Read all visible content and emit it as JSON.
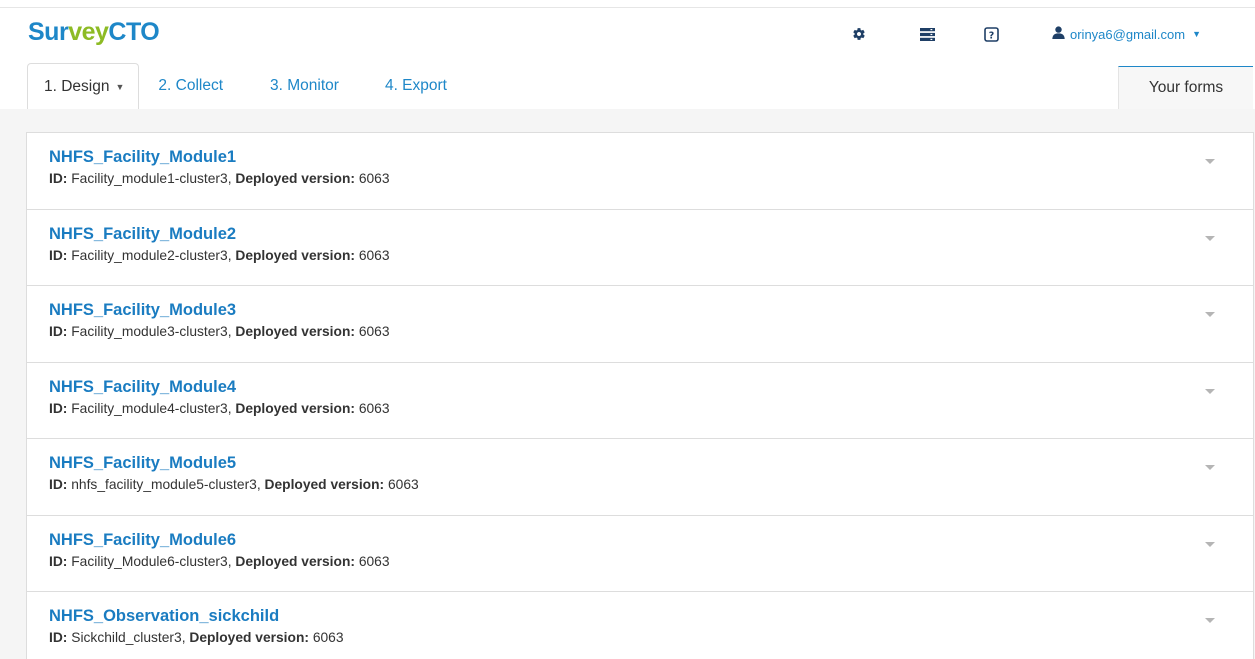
{
  "brand": {
    "part1": "Sur",
    "part2": "vey",
    "part3": "CTO",
    "colors": {
      "blue": "#1e87c8",
      "green": "#8dbb24"
    }
  },
  "header_icons": {
    "settings": "gear-icon",
    "servers": "server-stack-icon",
    "help": "help-icon"
  },
  "account": {
    "icon": "user-icon",
    "email": "orinya6@gmail.com"
  },
  "tabs": [
    {
      "label": "1. Design"
    },
    {
      "label": "2. Collect"
    },
    {
      "label": "3. Monitor"
    },
    {
      "label": "4. Export"
    }
  ],
  "your_forms": "Your forms",
  "labels": {
    "id": "ID:",
    "deployed": "Deployed version:"
  },
  "forms": [
    {
      "title": "NHFS_Facility_Module1",
      "id": "Facility_module1-cluster3",
      "version": "6063"
    },
    {
      "title": "NHFS_Facility_Module2",
      "id": "Facility_module2-cluster3",
      "version": "6063"
    },
    {
      "title": "NHFS_Facility_Module3",
      "id": "Facility_module3-cluster3",
      "version": "6063"
    },
    {
      "title": "NHFS_Facility_Module4",
      "id": "Facility_module4-cluster3",
      "version": "6063"
    },
    {
      "title": "NHFS_Facility_Module5",
      "id": "nhfs_facility_module5-cluster3",
      "version": "6063"
    },
    {
      "title": "NHFS_Facility_Module6",
      "id": "Facility_Module6-cluster3",
      "version": "6063"
    },
    {
      "title": "NHFS_Observation_sickchild",
      "id": "Sickchild_cluster3",
      "version": "6063"
    }
  ]
}
